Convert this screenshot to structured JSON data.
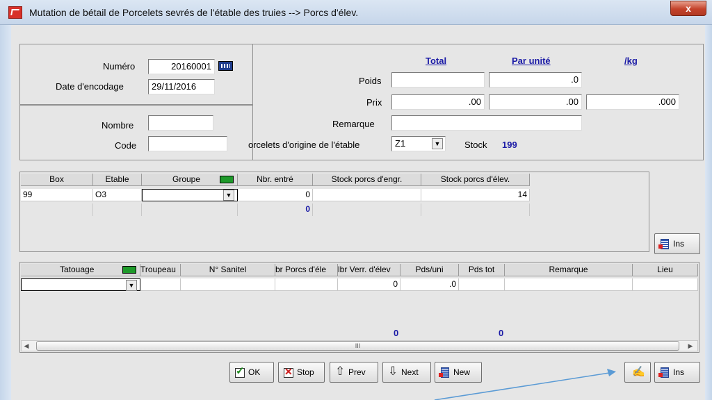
{
  "window": {
    "title": "Mutation de bétail de Porcelets sevrés de l'étable des truies --> Porcs d'élev.",
    "close_label": "x"
  },
  "form": {
    "numero_label": "Numéro",
    "numero_value": "20160001",
    "date_label": "Date d'encodage",
    "date_value": "29/11/2016",
    "nombre_label": "Nombre",
    "nombre_value": "",
    "code_label": "Code",
    "code_value": "",
    "col_total": "Total",
    "col_par_unite": "Par unité",
    "col_kg": "/kg",
    "poids_label": "Poids",
    "poids_total": "",
    "poids_unite": ".0",
    "prix_label": "Prix",
    "prix_total": ".00",
    "prix_unite": ".00",
    "prix_kg": ".000",
    "remarque_label": "Remarque",
    "remarque_value": "",
    "origine_label": "orcelets d'origine de l'étable",
    "origine_value": "Z1",
    "stock_label": "Stock",
    "stock_value": "199"
  },
  "grid1": {
    "headers": [
      "Box",
      "Etable",
      "Groupe",
      "Nbr. entré",
      "Stock porcs d'engr.",
      "Stock porcs d'élev."
    ],
    "row": {
      "box": "99",
      "etable": "O3",
      "groupe": "",
      "nbr_entre": "0",
      "stock_engr": "",
      "stock_elev": "14"
    },
    "total_nbr": "0",
    "ins_label": "Ins"
  },
  "grid2": {
    "headers": [
      "Tatouage",
      "Troupeau",
      "N° Sanitel",
      "br Porcs d'éle",
      "lbr Verr. d'élev",
      "Pds/uni",
      "Pds tot",
      "Remarque",
      "Lieu"
    ],
    "row": {
      "tatouage": "",
      "troupeau": "",
      "sanitel": "",
      "porcs": "",
      "verr": "0",
      "pds_uni": ".0",
      "pds_tot": "",
      "remarque": "",
      "lieu": ""
    },
    "total_verr": "0",
    "total_pds": "0",
    "scroll_grip": "III"
  },
  "buttons": {
    "ok": "OK",
    "stop": "Stop",
    "prev": "Prev",
    "next": "Next",
    "new": "New",
    "ins": "Ins"
  },
  "colors": {
    "accent_blue": "#1a1aa6",
    "green_marker": "#1e9a2a",
    "arrow": "#5b9bd5"
  }
}
